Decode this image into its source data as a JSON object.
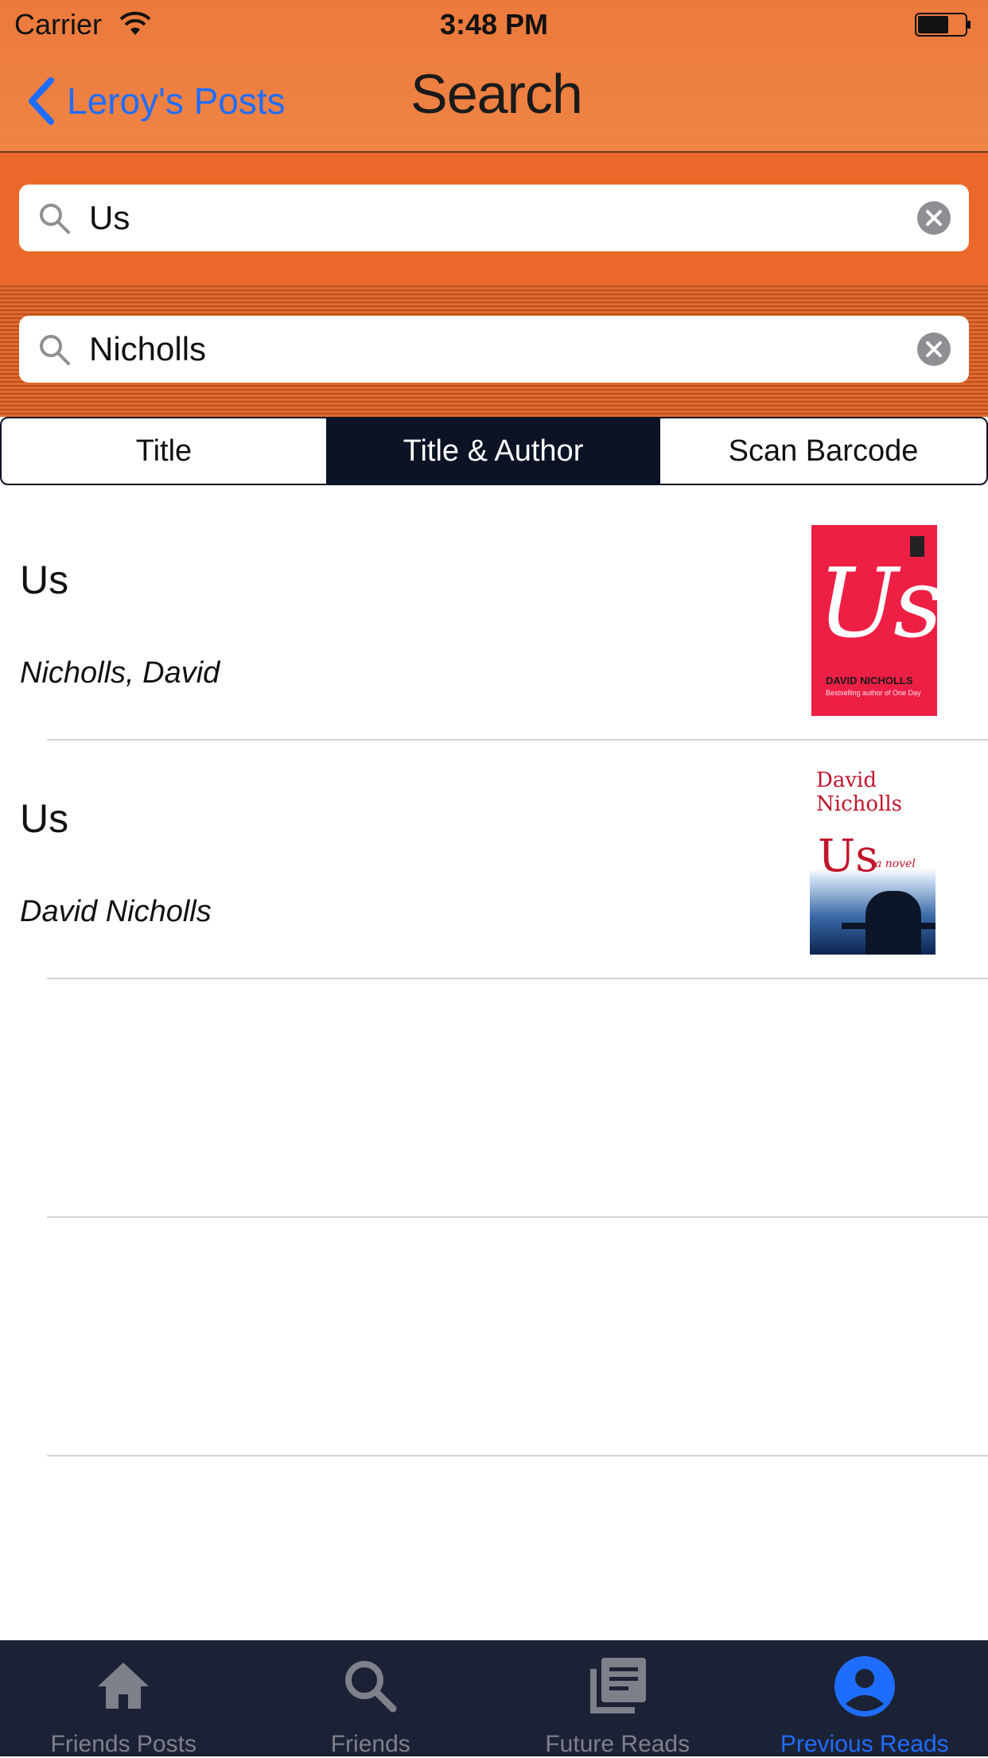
{
  "status_bar": {
    "carrier": "Carrier",
    "time": "3:48 PM"
  },
  "nav": {
    "back_label": "Leroy's Posts",
    "title": "Search"
  },
  "search": {
    "field1_value": "Us",
    "field2_value": "Nicholls"
  },
  "segmented": {
    "items": [
      "Title",
      "Title & Author",
      "Scan Barcode"
    ],
    "selected": "Title & Author"
  },
  "results": [
    {
      "title": "Us",
      "author": "Nicholls, David",
      "cover_text": {
        "title": "Us",
        "author": "DAVID NICHOLLS",
        "tagline": "Bestselling author of One Day"
      }
    },
    {
      "title": "Us",
      "author": "David Nicholls",
      "cover_text": {
        "author_line1": "David",
        "author_line2": "Nicholls",
        "title": "Us",
        "subtitle": "a novel"
      }
    }
  ],
  "tabbar": {
    "items": [
      {
        "label": "Friends Posts",
        "icon": "home-icon",
        "active": false
      },
      {
        "label": "Friends",
        "icon": "search-icon",
        "active": false
      },
      {
        "label": "Future Reads",
        "icon": "book-stack-icon",
        "active": false
      },
      {
        "label": "Previous Reads",
        "icon": "account-circle-icon",
        "active": true
      }
    ]
  },
  "colors": {
    "nav_orange": "#ec7a3c",
    "search_band": "#eb682a",
    "accent_blue": "#1f6dff",
    "segment_dark": "#0b1324",
    "tabbar_bg": "#1c2235"
  }
}
